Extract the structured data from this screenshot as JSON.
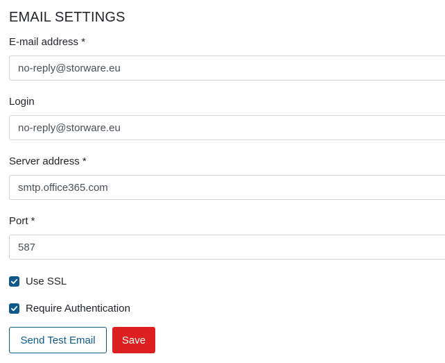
{
  "section": {
    "title": "EMAIL SETTINGS"
  },
  "fields": {
    "email": {
      "label": "E-mail address *",
      "value": "no-reply@storware.eu"
    },
    "login": {
      "label": "Login",
      "value": "no-reply@storware.eu"
    },
    "server": {
      "label": "Server address *",
      "value": "smtp.office365.com"
    },
    "port": {
      "label": "Port *",
      "value": "587"
    }
  },
  "checkboxes": {
    "use_ssl": {
      "label": "Use SSL",
      "checked": true
    },
    "require_auth": {
      "label": "Require Authentication",
      "checked": true
    }
  },
  "buttons": {
    "send_test": "Send Test Email",
    "save": "Save"
  },
  "colors": {
    "primary": "#0f5a8a",
    "danger": "#dc1f1f",
    "border": "#ced4da",
    "text": "#212529"
  }
}
